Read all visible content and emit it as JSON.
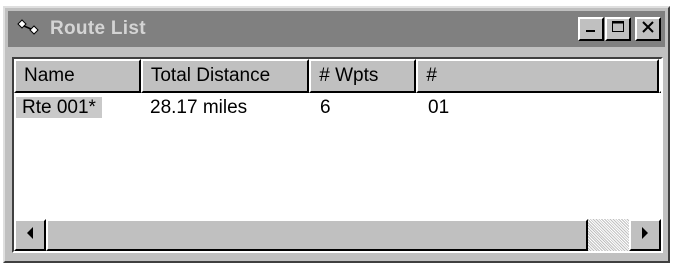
{
  "window": {
    "title": "Route List",
    "icons": {
      "app": "route-waypoints-icon",
      "minimize": "minimize-icon",
      "maximize": "maximize-icon",
      "close": "close-icon"
    }
  },
  "table": {
    "columns": [
      "Name",
      "Total Distance",
      "# Wpts",
      "#"
    ],
    "rows": [
      {
        "name": "Rte 001*",
        "total_distance": "28.17 miles",
        "wpts": "6",
        "num": "01",
        "selected": true
      }
    ]
  },
  "scrollbar": {
    "icons": {
      "left": "scroll-left-arrow-icon",
      "right": "scroll-right-arrow-icon"
    },
    "thumb_fraction": 0.93
  }
}
